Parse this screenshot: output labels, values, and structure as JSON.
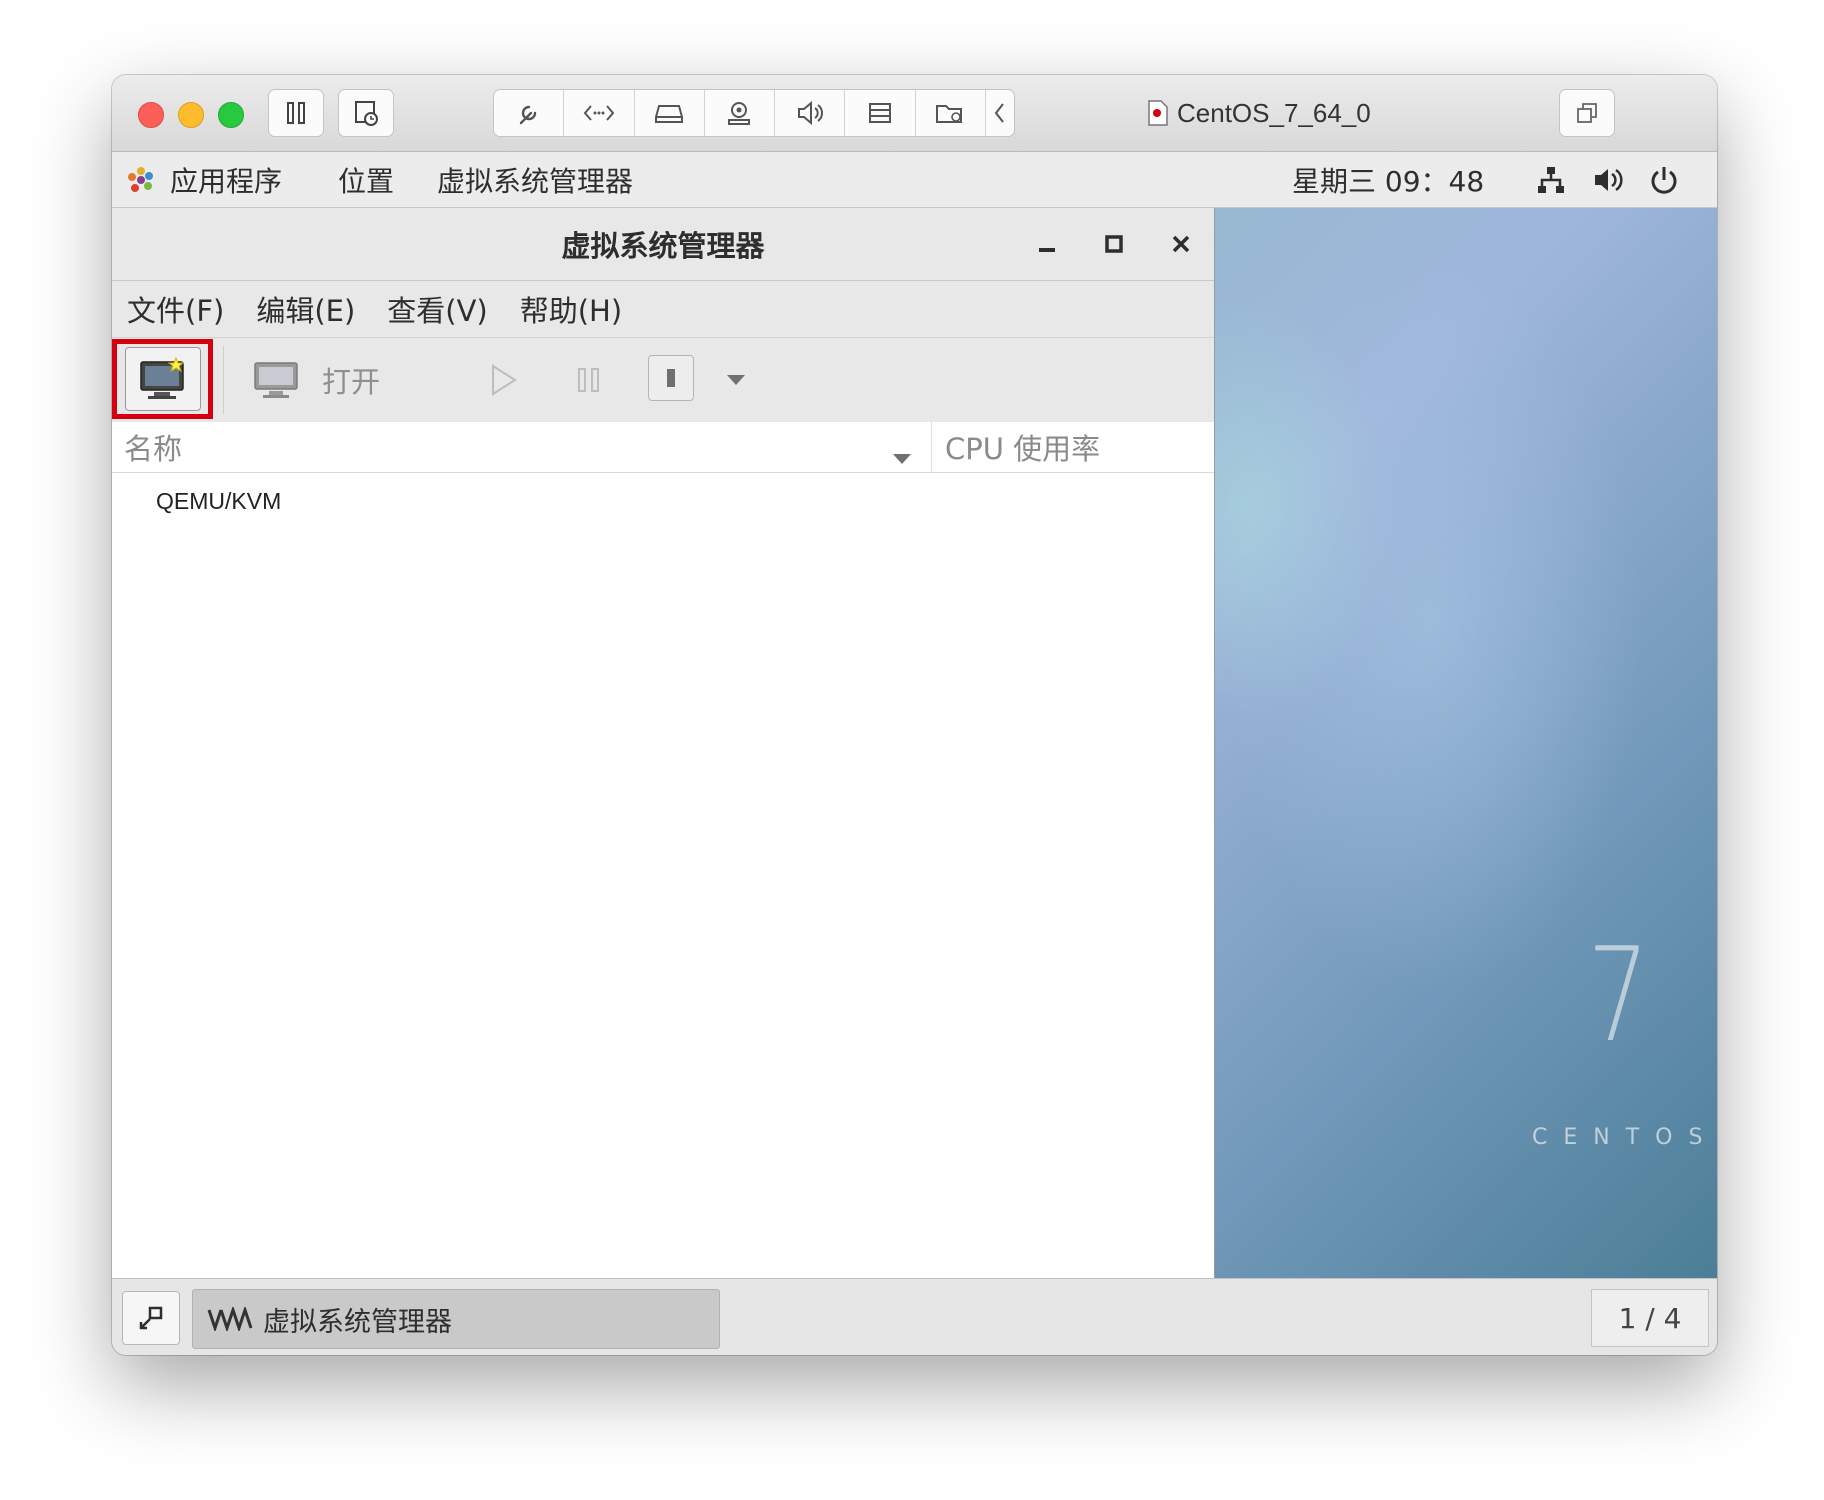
{
  "mac": {
    "vm_name": "CentOS_7_64_0",
    "toolbar_icons": [
      "wrench-icon",
      "code-arrows-icon",
      "disk-icon",
      "camera-icon",
      "speaker-icon",
      "printer-icon",
      "shared-folder-icon",
      "chevron-left-icon"
    ]
  },
  "gnome": {
    "applications": "应用程序",
    "places": "位置",
    "active_app": "虚拟系统管理器",
    "clock": "星期三 09：48"
  },
  "vm_window": {
    "title": "虚拟系统管理器",
    "menus": [
      "文件(F)",
      "编辑(E)",
      "查看(V)",
      "帮助(H)"
    ],
    "toolbar": {
      "open_label": "打开"
    },
    "columns": {
      "name": "名称",
      "cpu": "CPU 使用率"
    },
    "rows": [
      {
        "name": "QEMU/KVM"
      }
    ]
  },
  "desktop": {
    "version": "7",
    "brand": "CENTOS"
  },
  "taskbar": {
    "task_label": "虚拟系统管理器",
    "workspace": "1 / 4"
  },
  "colors": {
    "highlight": "#d4000f",
    "close_red": "#fc5f57",
    "minimize_yellow": "#fdbc2e",
    "zoom_green": "#28c840"
  }
}
